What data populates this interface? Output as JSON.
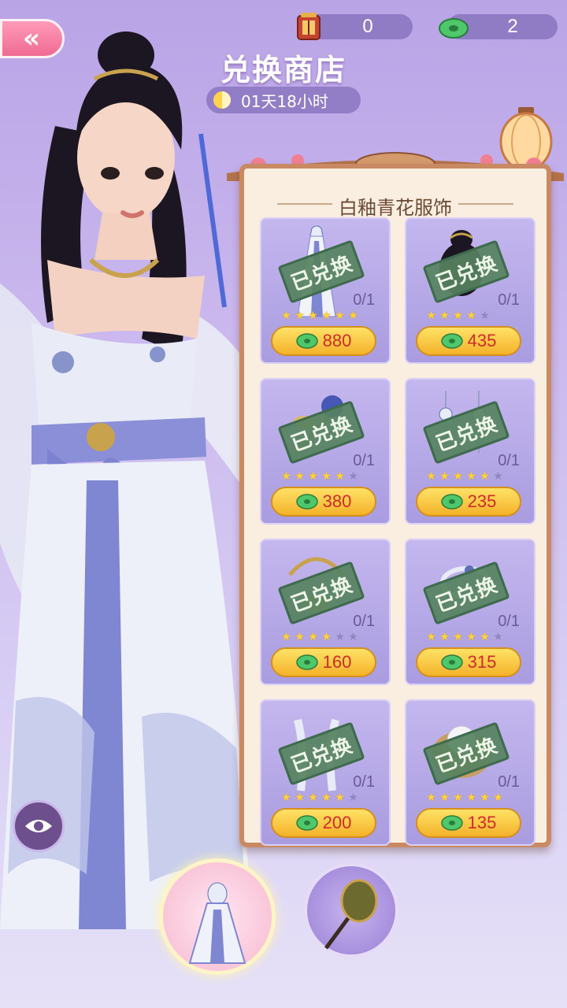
{
  "header": {
    "back_label": "«",
    "title": "兑换商店",
    "timer": "01天18小时"
  },
  "currencies": [
    {
      "icon": "lantern-token-icon",
      "value": "0"
    },
    {
      "icon": "jade-icon",
      "value": "2"
    }
  ],
  "shop": {
    "section_title": "白釉青花服饰",
    "items": [
      {
        "name": "dress",
        "stamp": "已兑换",
        "count": "0/1",
        "stars": 6,
        "max_stars": 6,
        "price": "880"
      },
      {
        "name": "hairstyle",
        "stamp": "已兑换",
        "count": "0/1",
        "stars": 4,
        "max_stars": 5,
        "price": "435"
      },
      {
        "name": "hair-ornament",
        "stamp": "已兑换",
        "count": "0/1",
        "stars": 5,
        "max_stars": 6,
        "price": "380"
      },
      {
        "name": "earrings",
        "stamp": "已兑换",
        "count": "0/1",
        "stars": 5,
        "max_stars": 6,
        "price": "235"
      },
      {
        "name": "necklace",
        "stamp": "已兑换",
        "count": "0/1",
        "stars": 4,
        "max_stars": 6,
        "price": "160"
      },
      {
        "name": "bracelet",
        "stamp": "已兑换",
        "count": "0/1",
        "stars": 5,
        "max_stars": 6,
        "price": "315"
      },
      {
        "name": "sleeves",
        "stamp": "已兑换",
        "count": "0/1",
        "stars": 5,
        "max_stars": 6,
        "price": "200"
      },
      {
        "name": "pearl-ornament",
        "stamp": "已兑换",
        "count": "0/1",
        "stars": 6,
        "max_stars": 6,
        "price": "135"
      }
    ]
  },
  "colors": {
    "stamp_green": "#56825f",
    "price_red": "#cf2b2b",
    "panel_border": "#c98a63"
  }
}
